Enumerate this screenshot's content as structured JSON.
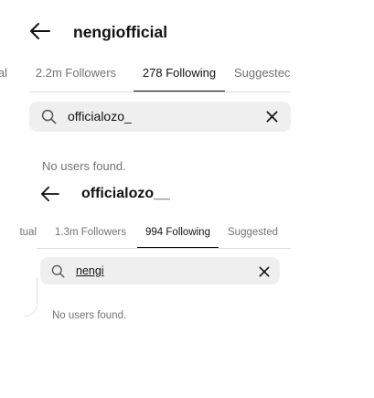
{
  "panels": [
    {
      "username": "nengiofficial",
      "tabs": [
        {
          "label": "al",
          "active": false
        },
        {
          "label": "2.2m Followers",
          "active": false
        },
        {
          "label": "278 Following",
          "active": true
        },
        {
          "label": "Suggestec",
          "active": false
        }
      ],
      "search": {
        "value": "officialozo_"
      },
      "empty_message": "No users found."
    },
    {
      "username": "officialozo__",
      "tabs": [
        {
          "label": "tual",
          "active": false
        },
        {
          "label": "1.3m Followers",
          "active": false
        },
        {
          "label": "994 Following",
          "active": true
        },
        {
          "label": "Suggested",
          "active": false
        }
      ],
      "search": {
        "value": "nengi"
      },
      "empty_message": "No users found."
    }
  ],
  "icons": {
    "back": "arrow-left-icon",
    "search": "search-icon",
    "clear": "close-icon"
  },
  "colors": {
    "text_primary": "#111111",
    "text_secondary": "#737373",
    "search_background": "#efefef",
    "divider": "#dbdbdb",
    "background": "#ffffff"
  }
}
